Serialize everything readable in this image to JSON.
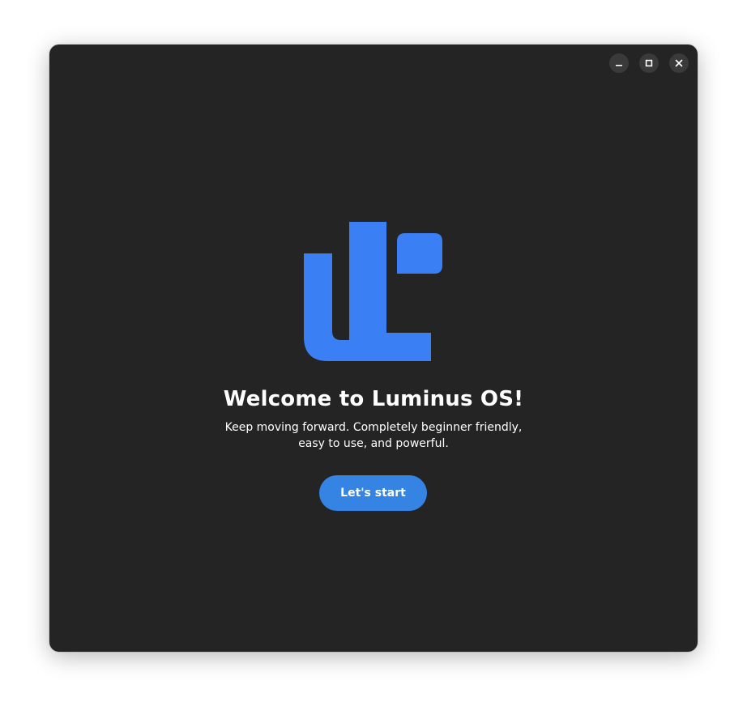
{
  "window": {
    "controls": {
      "minimize_icon": "minimize-icon",
      "maximize_icon": "maximize-icon",
      "close_icon": "close-icon"
    }
  },
  "logo": {
    "name": "luminus-os-logo",
    "color": "#3a7ff4"
  },
  "welcome": {
    "title": "Welcome to Luminus OS!",
    "subtitle_line1": "Keep moving forward. Completely beginner friendly,",
    "subtitle_line2": "easy to use, and powerful.",
    "start_label": "Let's start"
  },
  "colors": {
    "window_background": "#242424",
    "accent": "#3584e4",
    "text": "#ffffff"
  }
}
